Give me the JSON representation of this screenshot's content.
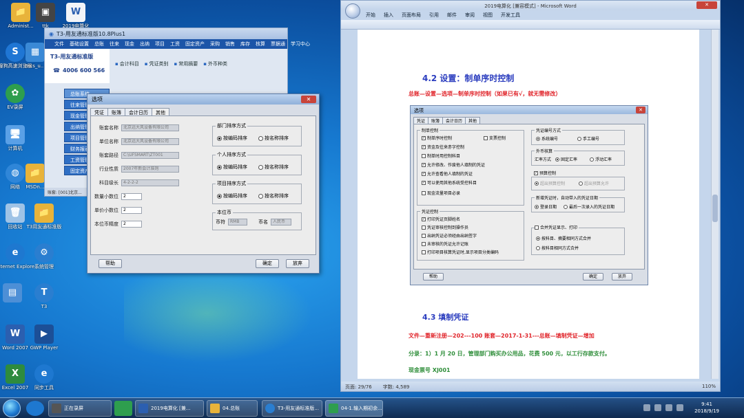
{
  "desktop": {
    "icons": [
      {
        "label": "Administ..."
      },
      {
        "label": "ttk"
      },
      {
        "label": "2019电算化"
      },
      {
        "label": "搜狗高速浏览器"
      },
      {
        "label": "mcs_u..."
      },
      {
        "label": "EV录屏"
      },
      {
        "label": "计算机"
      },
      {
        "label": "网络"
      },
      {
        "label": "MSDn..."
      },
      {
        "label": "回收站"
      },
      {
        "label": "T3用友通标准版"
      },
      {
        "label": "Internet Explorer"
      },
      {
        "label": "系统管理"
      },
      {
        "label": "T3"
      },
      {
        "label": "Word 2007"
      },
      {
        "label": "GWP Player"
      },
      {
        "label": "Excel 2007"
      },
      {
        "label": "同步工具"
      }
    ]
  },
  "t3": {
    "title": "T3-用友通标准版10.8Plus1",
    "menu": [
      "文件",
      "基础设置",
      "总账",
      "往来",
      "现金",
      "出纳",
      "项目",
      "工资",
      "固定资产",
      "采购",
      "销售",
      "库存",
      "核算",
      "票据通",
      "学习中心"
    ],
    "brand": "T3-用友通标准版",
    "phone": "4006 600 566",
    "nav": [
      "会计科目",
      "凭证类别",
      "常用摘要",
      "外币种类"
    ],
    "side": [
      "总账系统",
      "往来管理",
      "现金管理",
      "出纳管理",
      "项目管理",
      "财务报表",
      "工资管理",
      "固定资产"
    ],
    "status": "账套: [001]北京..."
  },
  "options_dialog": {
    "title": "选项",
    "tabs": [
      "凭证",
      "账簿",
      "会计日历",
      "其他"
    ],
    "fields": [
      {
        "label": "账套名称",
        "value": "北京远大风设备有限公司"
      },
      {
        "label": "单位名称",
        "value": "北京远大风设备有限公司"
      },
      {
        "label": "账套路径",
        "value": "C:\\UFSMART\\ZT001"
      },
      {
        "label": "行业性质",
        "value": "2007年新会计准则"
      },
      {
        "label": "科目级长",
        "value": "4-2-2-2"
      },
      {
        "label": "数量小数位",
        "value": "2"
      },
      {
        "label": "单价小数位",
        "value": "2"
      },
      {
        "label": "本位币精度",
        "value": "2"
      }
    ],
    "groups": [
      {
        "title": "部门排序方式",
        "opt1": "按编码排序",
        "opt2": "按名称排序"
      },
      {
        "title": "个人排序方式",
        "opt1": "按编码排序",
        "opt2": "按名称排序"
      },
      {
        "title": "项目排序方式",
        "opt1": "按编码排序",
        "opt2": "按名称排序"
      }
    ],
    "currency": {
      "title": "本位币",
      "code_label": "币符",
      "code": "RMB",
      "name_label": "币名",
      "name": "人民币"
    },
    "help": "帮助",
    "ok": "确定",
    "cancel": "放弃"
  },
  "word": {
    "title": "2019电算化 [兼容模式] - Microsoft Word",
    "ribbon_tabs": [
      "开始",
      "插入",
      "页面布局",
      "引用",
      "邮件",
      "审阅",
      "视图",
      "开发工具"
    ],
    "heading_42": "4.2  设置：制单序时控制",
    "instruction": "总账—设置—选项—制单序时控制（如果已有√，就无需修改）",
    "heading_43": "4.3  填制凭证",
    "line1": "文件—重新注册—202---100 账套—2017-1-31---总账—填制凭证—增加",
    "line2": "分录：1）1 月 20 日，管理部门购买办公用品，花费 500 元，以工行存款支付。",
    "line3": "现金票号 XJ001",
    "status_page": "页面: 29/76",
    "status_words": "字数: 4,589",
    "zoom": "110%",
    "embedded": {
      "title": "选项",
      "tabs": [
        "凭证",
        "账簿",
        "会计日历",
        "其他"
      ],
      "g1_title": "制单控制",
      "g1_items": [
        {
          "label": "制单序时控制",
          "checked": true
        },
        {
          "label": "支票控制",
          "checked": false
        },
        {
          "label": "资金及往来赤字控制",
          "checked": true
        },
        {
          "label": "制单时用控制科目",
          "checked": false
        },
        {
          "label": "允许修改、作废他人填制的凭证",
          "checked": true
        },
        {
          "label": "允许查看他人填制的凭证",
          "checked": true
        },
        {
          "label": "可以使用其他系统受控科目",
          "checked": true
        },
        {
          "label": "现金流量项目必录",
          "checked": false
        }
      ],
      "g2_title": "凭证控制",
      "g2_items": [
        {
          "label": "打印凭证页脚姓名",
          "checked": true
        },
        {
          "label": "凭证审核控制到操作员",
          "checked": false
        },
        {
          "label": "出纳凭证必须经由出纳签字",
          "checked": false
        },
        {
          "label": "未审核的凭证允许记账",
          "checked": false
        },
        {
          "label": "打印项目核算凭证时,显示项目分类编码",
          "checked": false
        }
      ],
      "g3_title": "凭证编号方式",
      "g3_opt1": "系统编号",
      "g3_opt2": "手工编号",
      "g4_title": "外币核算",
      "g4_rate": "汇率方式",
      "g4_opt1": "固定汇率",
      "g4_opt2": "浮动汇率",
      "budget": "预算控制",
      "budget_sub1": "超出预算控制",
      "budget_sub2": "超出预算允许",
      "g5_title": "新增凭证时，自动带入的凭证日期",
      "g5_opt1": "登录日期",
      "g5_opt2": "最后一次录入的凭证日期",
      "merge": "合并凭证显示、打印",
      "merge_opt1": "按科目、摘要相同方式合并",
      "merge_opt2": "按科目相同方式合并",
      "help": "帮助",
      "ok": "确定",
      "cancel": "放弃"
    }
  },
  "taskbar": {
    "tasks": [
      "正在录屏",
      "2019电算化 [兼...",
      "04.总账",
      "T3-用友通标准版...",
      "04-1.输入期初余..."
    ],
    "time": "9:41",
    "date": "2018/9/19"
  }
}
